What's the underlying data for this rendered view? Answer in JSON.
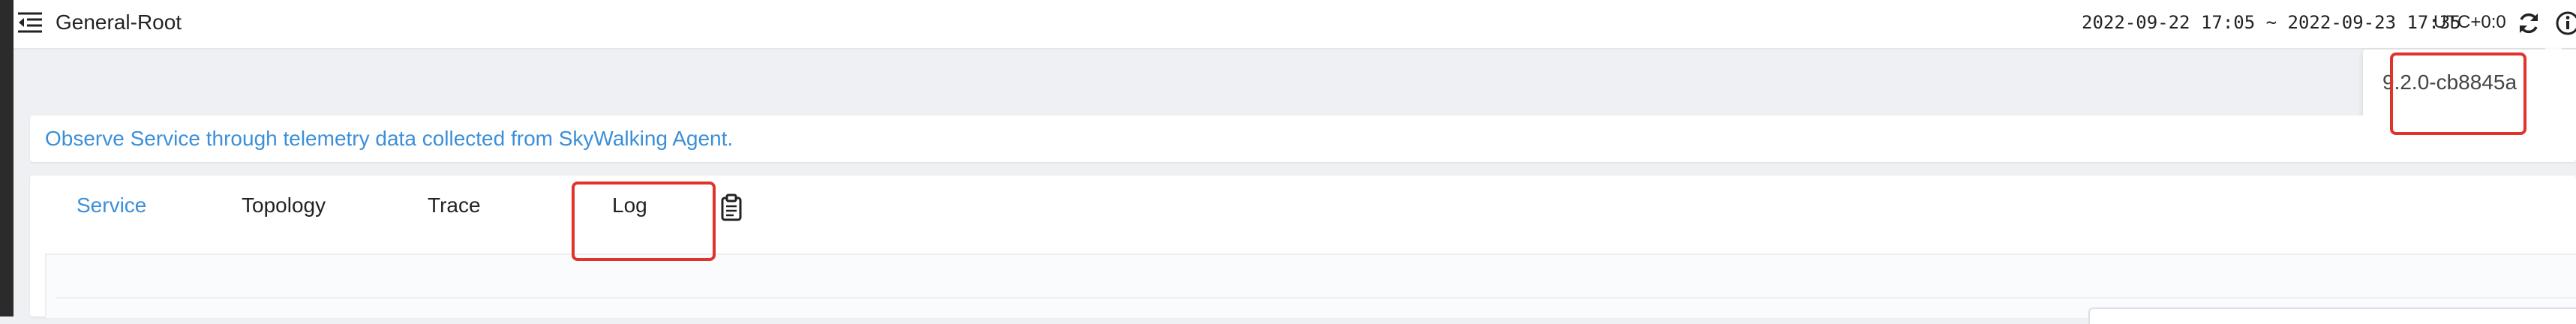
{
  "header": {
    "title": "General-Root",
    "time_range": "2022-09-22 17:05 ~ 2022-09-23 17:35",
    "timezone": "UTC+0:0"
  },
  "version_popover": {
    "text": "9.2.0-cb8845a"
  },
  "description": "Observe Service through telemetry data collected from SkyWalking Agent.",
  "tabs": [
    {
      "label": "Service",
      "active": true
    },
    {
      "label": "Topology",
      "active": false
    },
    {
      "label": "Trace",
      "active": false
    },
    {
      "label": "Log",
      "active": false
    }
  ],
  "icons": {
    "menu": "menu-toggle-icon",
    "refresh": "refresh-icon",
    "info": "info-icon",
    "clipboard": "clipboard-icon"
  },
  "colors": {
    "accent": "#3b8fd8",
    "highlight": "#e0332b",
    "text": "#222222",
    "background": "#eef0f3",
    "sidebar": "#2b2b2b"
  }
}
